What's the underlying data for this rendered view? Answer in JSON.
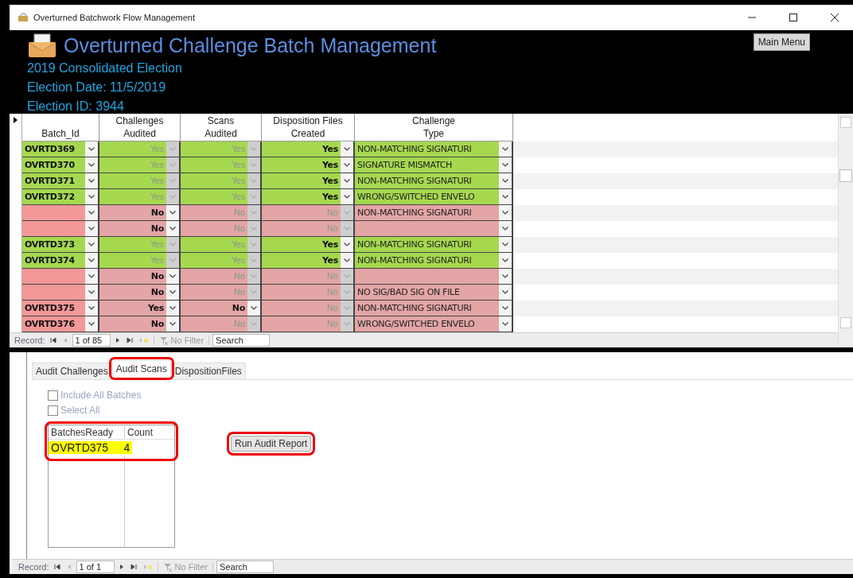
{
  "window": {
    "title": "Overturned Batchwork Flow Management"
  },
  "header": {
    "title": "Overturned Challenge Batch Management",
    "lines": [
      "2019 Consolidated Election",
      "Election Date: 11/5/2019",
      "Election ID: 3944"
    ],
    "menu_button": "Main Menu"
  },
  "grid": {
    "columns": [
      {
        "lines": [
          "Batch_Id"
        ]
      },
      {
        "lines": [
          "Challenges",
          "Audited"
        ]
      },
      {
        "lines": [
          "Scans",
          "Audited"
        ]
      },
      {
        "lines": [
          "Disposition Files",
          "Created"
        ]
      },
      {
        "lines": [
          "Challenge",
          "Type"
        ]
      }
    ],
    "rows": [
      {
        "batch_id": "OVRTD369",
        "ready": true,
        "challenges_audited": {
          "value": "Yes",
          "enabled": false
        },
        "scans_audited": {
          "value": "Yes",
          "enabled": false
        },
        "disposition_files_created": {
          "value": "Yes",
          "enabled": true
        },
        "challenge_type": "NON-MATCHING SIGNATURI"
      },
      {
        "batch_id": "OVRTD370",
        "ready": true,
        "challenges_audited": {
          "value": "Yes",
          "enabled": false
        },
        "scans_audited": {
          "value": "Yes",
          "enabled": false
        },
        "disposition_files_created": {
          "value": "Yes",
          "enabled": true
        },
        "challenge_type": "SIGNATURE MISMATCH"
      },
      {
        "batch_id": "OVRTD371",
        "ready": true,
        "challenges_audited": {
          "value": "Yes",
          "enabled": false
        },
        "scans_audited": {
          "value": "Yes",
          "enabled": false
        },
        "disposition_files_created": {
          "value": "Yes",
          "enabled": true
        },
        "challenge_type": "NON-MATCHING SIGNATURI"
      },
      {
        "batch_id": "OVRTD372",
        "ready": true,
        "challenges_audited": {
          "value": "Yes",
          "enabled": false
        },
        "scans_audited": {
          "value": "Yes",
          "enabled": false
        },
        "disposition_files_created": {
          "value": "Yes",
          "enabled": true
        },
        "challenge_type": "WRONG/SWITCHED ENVELO"
      },
      {
        "ready": false,
        "challenges_audited": {
          "value": "No",
          "enabled": true
        },
        "scans_audited": {
          "value": "No",
          "enabled": false
        },
        "disposition_files_created": {
          "value": "No",
          "enabled": false
        },
        "challenge_type": "NON-MATCHING SIGNATURI"
      },
      {
        "ready": false,
        "challenges_audited": {
          "value": "No",
          "enabled": true
        },
        "scans_audited": {
          "value": "No",
          "enabled": false
        },
        "disposition_files_created": {
          "value": "No",
          "enabled": false
        }
      },
      {
        "batch_id": "OVRTD373",
        "ready": true,
        "challenges_audited": {
          "value": "Yes",
          "enabled": false
        },
        "scans_audited": {
          "value": "Yes",
          "enabled": false
        },
        "disposition_files_created": {
          "value": "Yes",
          "enabled": true
        },
        "challenge_type": "NON-MATCHING SIGNATURI"
      },
      {
        "batch_id": "OVRTD374",
        "ready": true,
        "challenges_audited": {
          "value": "Yes",
          "enabled": false
        },
        "scans_audited": {
          "value": "Yes",
          "enabled": false
        },
        "disposition_files_created": {
          "value": "Yes",
          "enabled": true
        },
        "challenge_type": "NON-MATCHING SIGNATURI"
      },
      {
        "ready": false,
        "challenges_audited": {
          "value": "No",
          "enabled": true
        },
        "scans_audited": {
          "value": "No",
          "enabled": false
        },
        "disposition_files_created": {
          "value": "No",
          "enabled": false
        }
      },
      {
        "ready": false,
        "challenges_audited": {
          "value": "No",
          "enabled": true
        },
        "scans_audited": {
          "value": "No",
          "enabled": false
        },
        "disposition_files_created": {
          "value": "No",
          "enabled": false
        },
        "challenge_type": "NO SIG/BAD SIG ON FILE"
      },
      {
        "batch_id": "OVRTD375",
        "ready": false,
        "challenges_audited": {
          "value": "Yes",
          "enabled": true
        },
        "scans_audited": {
          "value": "No",
          "enabled": true
        },
        "disposition_files_created": {
          "value": "No",
          "enabled": false
        },
        "challenge_type": "NON-MATCHING SIGNATURI"
      },
      {
        "batch_id": "OVRTD376",
        "ready": false,
        "challenges_audited": {
          "value": "No",
          "enabled": true
        },
        "scans_audited": {
          "value": "No",
          "enabled": false
        },
        "disposition_files_created": {
          "value": "No",
          "enabled": false
        },
        "challenge_type": "WRONG/SWITCHED ENVELO"
      }
    ],
    "record_nav": {
      "label": "Record:",
      "position": "1 of 85",
      "filter": "No Filter",
      "search": "Search"
    }
  },
  "tabs": [
    {
      "label": "Audit Challenges",
      "selected": false,
      "highlighted": false
    },
    {
      "label": "Audit Scans",
      "selected": true,
      "highlighted": true
    },
    {
      "label": "DispositionFiles",
      "selected": false,
      "highlighted": false
    }
  ],
  "audit_scans": {
    "checkboxes": [
      {
        "label": "Include All Batches",
        "checked": false,
        "disabled": true
      },
      {
        "label": "Select All",
        "checked": false,
        "disabled": true
      }
    ],
    "list": {
      "highlighted": true,
      "columns": [
        "BatchesReady",
        "Count"
      ],
      "rows": [
        {
          "batch": "OVRTD375",
          "count": "4",
          "selected": true
        }
      ]
    },
    "run_button": {
      "label": "Run Audit Report",
      "highlighted": true
    }
  },
  "record_nav": {
    "label": "Record:",
    "position": "1 of 1",
    "filter": "No Filter",
    "search": "Search"
  }
}
